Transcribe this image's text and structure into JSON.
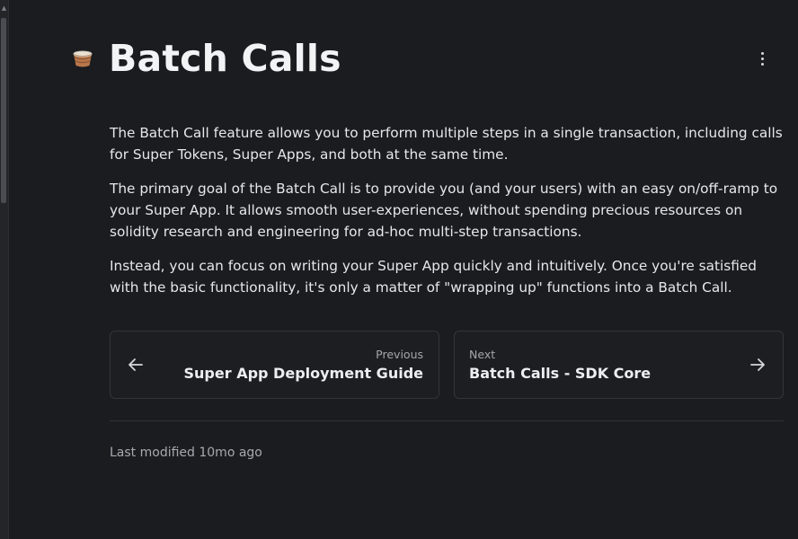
{
  "page": {
    "title": "Batch Calls",
    "title_icon": "basket-emoji-icon"
  },
  "content": {
    "paragraphs": [
      "The Batch Call feature allows you to perform multiple steps in a single transaction, including calls for Super Tokens, Super Apps, and both at the same time.",
      "The primary goal of the Batch Call is to provide you (and your users) with an easy on/off-ramp to your Super App. It allows smooth user-experiences, without spending precious resources on solidity research and engineering for ad-hoc multi-step transactions.",
      "Instead, you can focus on writing your Super App quickly and intuitively. Once you're satisfied with the basic functionality, it's only a matter of \"wrapping up\" functions into a Batch Call."
    ]
  },
  "nav": {
    "previous": {
      "kicker": "Previous",
      "title": "Super App Deployment Guide",
      "icon": "arrow-left-icon"
    },
    "next": {
      "kicker": "Next",
      "title": "Batch Calls - SDK Core",
      "icon": "arrow-right-icon"
    }
  },
  "footer": {
    "last_modified": "Last modified 10mo ago"
  },
  "icons": {
    "menu": "more-vertical-icon"
  },
  "colors": {
    "background": "#1b1c1f",
    "text": "#e6e7ea",
    "muted": "#a6a9b0",
    "border": "#33353a"
  }
}
